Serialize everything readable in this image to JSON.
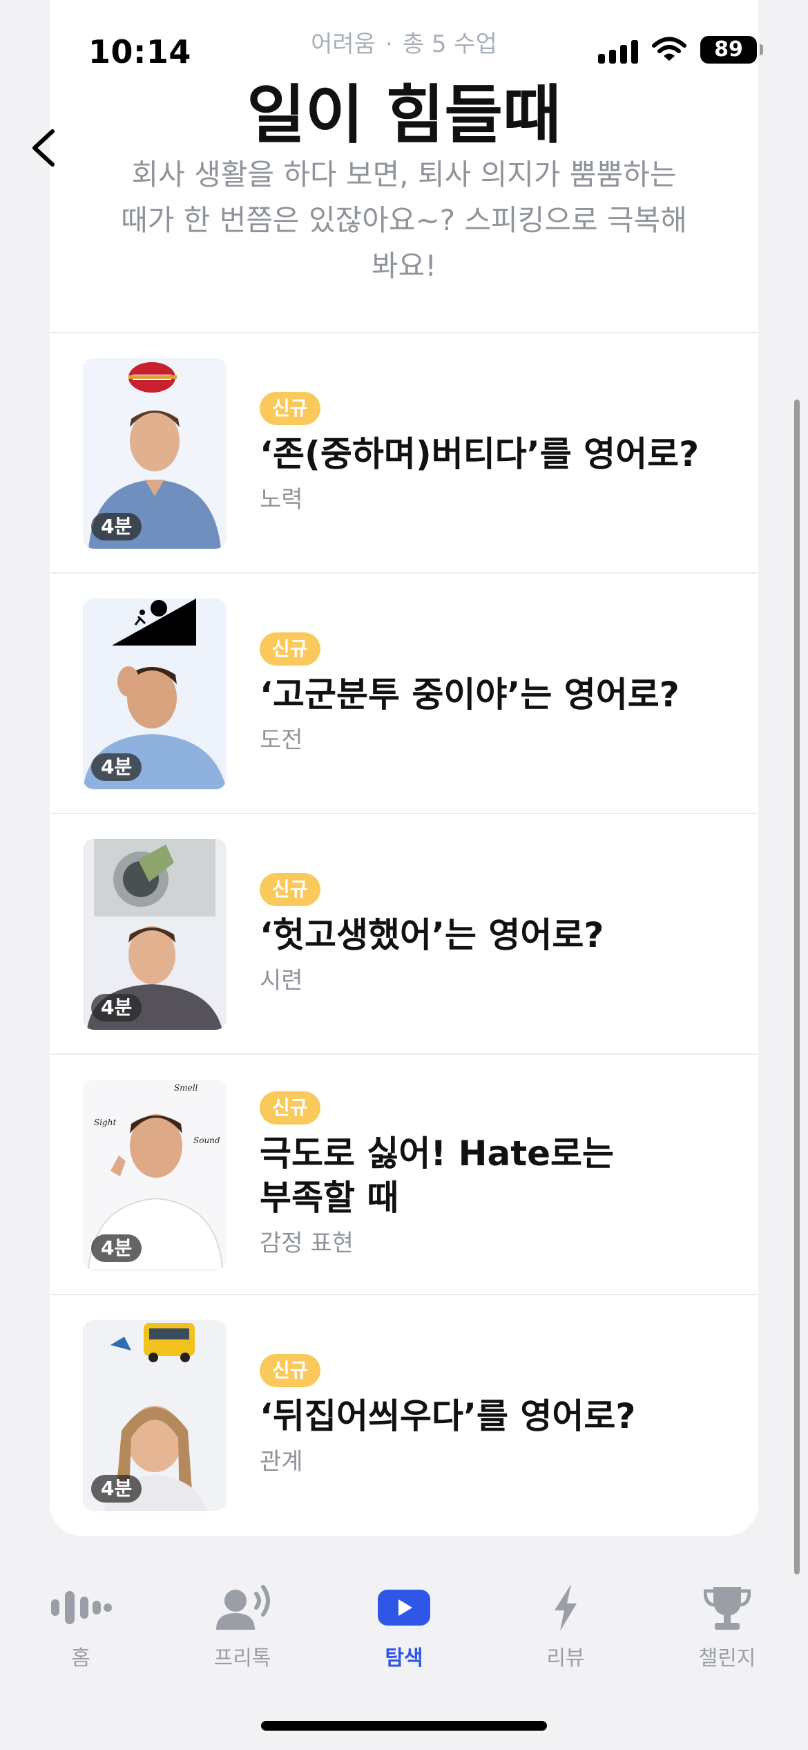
{
  "status_bar": {
    "time": "10:14",
    "battery": "89"
  },
  "header": {
    "difficulty": "어려움",
    "separator": "·",
    "lesson_count": "총 5 수업",
    "title": "일이 힘들때",
    "description": "회사 생활을 하다 보면, 퇴사 의지가 뿜뿜하는 때가 한 번쯤은 있잖아요~? 스피킹으로 극복해 봐요!"
  },
  "lessons": [
    {
      "badge": "신규",
      "title": "‘존(중하며)버티다’를 영어로?",
      "category": "노력",
      "duration": "4분"
    },
    {
      "badge": "신규",
      "title": "‘고군분투 중이야’는 영어로?",
      "category": "도전",
      "duration": "4분"
    },
    {
      "badge": "신규",
      "title": "‘헛고생했어’는 영어로?",
      "category": "시련",
      "duration": "4분"
    },
    {
      "badge": "신규",
      "title": "극도로 싫어! Hate로는 부족할 때",
      "category": "감정 표현",
      "duration": "4분"
    },
    {
      "badge": "신규",
      "title": "‘뒤집어씌우다’를 영어로?",
      "category": "관계",
      "duration": "4분"
    }
  ],
  "thumb_captions": {
    "sight": "Sight",
    "smell": "Smell",
    "sound": "Sound"
  },
  "tabs": [
    {
      "label": "홈",
      "icon": "voice-wave-icon"
    },
    {
      "label": "프리톡",
      "icon": "person-speaking-icon"
    },
    {
      "label": "탐색",
      "icon": "play-icon",
      "active": true
    },
    {
      "label": "리뷰",
      "icon": "lightning-icon"
    },
    {
      "label": "챌린지",
      "icon": "trophy-icon"
    }
  ],
  "colors": {
    "accent": "#2f56e6",
    "badge": "#f9c95c",
    "text_muted": "#8f949b"
  }
}
